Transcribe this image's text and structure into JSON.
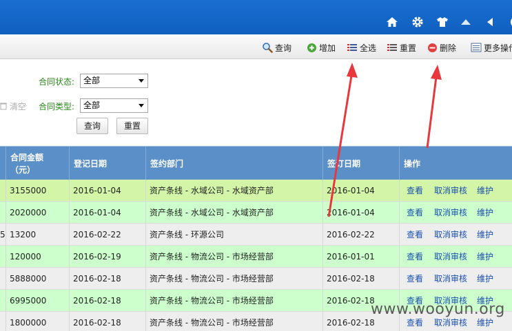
{
  "toolbar": {
    "query": "查询",
    "add": "增加",
    "select_all": "全选",
    "reset": "重置",
    "delete": "删除",
    "more": "更多操作"
  },
  "filter": {
    "status_label": "合同状态:",
    "status_value": "全部",
    "type_label": "合同类型:",
    "type_value": "全部",
    "clear": "清空",
    "query_btn": "查询",
    "reset_btn": "重置"
  },
  "table": {
    "headers": {
      "amount_line1": "合同金额",
      "amount_line2": "（元）",
      "register_date": "登记日期",
      "dept": "签约部门",
      "sign_date": "签订日期",
      "ops": "操作"
    },
    "rows": [
      {
        "amount": "3155000",
        "register_date": "2016-01-04",
        "dept": "资产条线 - 水域公司 - 水域资产部",
        "sign_date": "2016-01-04",
        "view": "查看",
        "cancel": "取消审核",
        "maintain": "维护",
        "left": ""
      },
      {
        "amount": "2020000",
        "register_date": "2016-01-04",
        "dept": "资产条线 - 水域公司 - 水域资产部",
        "sign_date": "2016-01-04",
        "view": "查看",
        "cancel": "取消审核",
        "maintain": "维护",
        "left": ""
      },
      {
        "amount": "13200",
        "register_date": "2016-02-22",
        "dept": "资产条线 - 环源公司",
        "sign_date": "2016-02-22",
        "view": "查看",
        "cancel": "取消审核",
        "maintain": "维护",
        "left": "5"
      },
      {
        "amount": "120000",
        "register_date": "2016-02-19",
        "dept": "资产条线 - 物流公司 - 市场经营部",
        "sign_date": "2016-01-01",
        "view": "查看",
        "cancel": "取消审核",
        "maintain": "维护",
        "left": ""
      },
      {
        "amount": "5888000",
        "register_date": "2016-02-18",
        "dept": "资产条线 - 物流公司 - 市场经营部",
        "sign_date": "2016-02-18",
        "view": "查看",
        "cancel": "取消审核",
        "maintain": "维护",
        "left": ""
      },
      {
        "amount": "6995000",
        "register_date": "2016-02-18",
        "dept": "资产条线 - 物流公司 - 市场经营部",
        "sign_date": "2016-02-18",
        "view": "查看",
        "cancel": "取消审核",
        "maintain": "维护",
        "left": ""
      },
      {
        "amount": "1800000",
        "register_date": "2016-02-18",
        "dept": "资产条线 - 物流公司 - 市场经营部",
        "sign_date": "2016-02-18",
        "view": "查看",
        "cancel": "取消审核",
        "maintain": "维护",
        "left": ""
      }
    ]
  },
  "colors": {
    "topbar": "#1565c8",
    "header": "#5a8fc8",
    "row_selected": "#d2f5a8",
    "row_green": "#ccffcc",
    "row_gray": "#eeeeee",
    "annotation_arrow": "#e8383d"
  },
  "icons": [
    "home-icon",
    "gear-icon",
    "shirt-icon",
    "caret-up-icon",
    "caret-left-icon",
    "circle-icon",
    "search-icon",
    "add-icon",
    "select-all-icon",
    "reset-icon",
    "delete-icon",
    "list-icon",
    "trash-icon"
  ],
  "watermark": "www.wooyun.org"
}
